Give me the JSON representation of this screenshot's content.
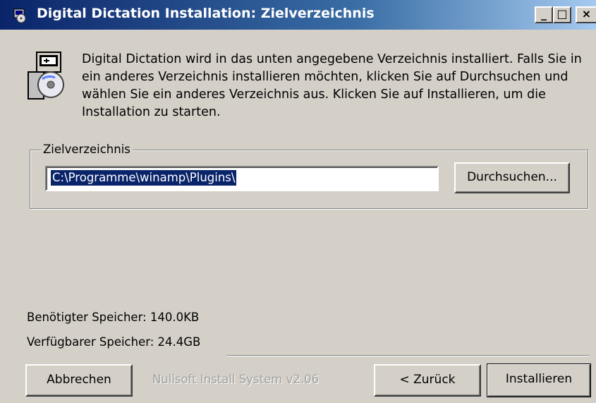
{
  "window": {
    "title": "Digital Dictation Installation: Zielverzeichnis",
    "icon": "installer-icon",
    "controls": {
      "minimize": "_",
      "maximize": "□",
      "close": "×"
    }
  },
  "header": {
    "icon": "installer-box-icon",
    "text": "Digital Dictation wird in das unten angegebene Verzeichnis installiert. Falls Sie in ein anderes Verzeichnis installieren möchten, klicken Sie auf Durchsuchen und wählen Sie ein anderes Verzeichnis aus. Klicken Sie auf Installieren, um die Installation zu starten."
  },
  "destination": {
    "group_label": "Zielverzeichnis",
    "path_value": "C:\\Programme\\winamp\\Plugins\\",
    "browse_label": "Durchsuchen..."
  },
  "space": {
    "required": "Benötigter Speicher: 140.0KB",
    "available": "Verfügbarer Speicher: 24.4GB"
  },
  "footer": {
    "cancel_label": "Abbrechen",
    "branding": "Nullsoft Install System v2.06",
    "back_label": "< Zurück",
    "install_label": "Installieren"
  },
  "colors": {
    "titlebar_start": "#0a246a",
    "titlebar_end": "#a6caf0",
    "face": "#d4d0c8",
    "selection": "#0a246a"
  }
}
